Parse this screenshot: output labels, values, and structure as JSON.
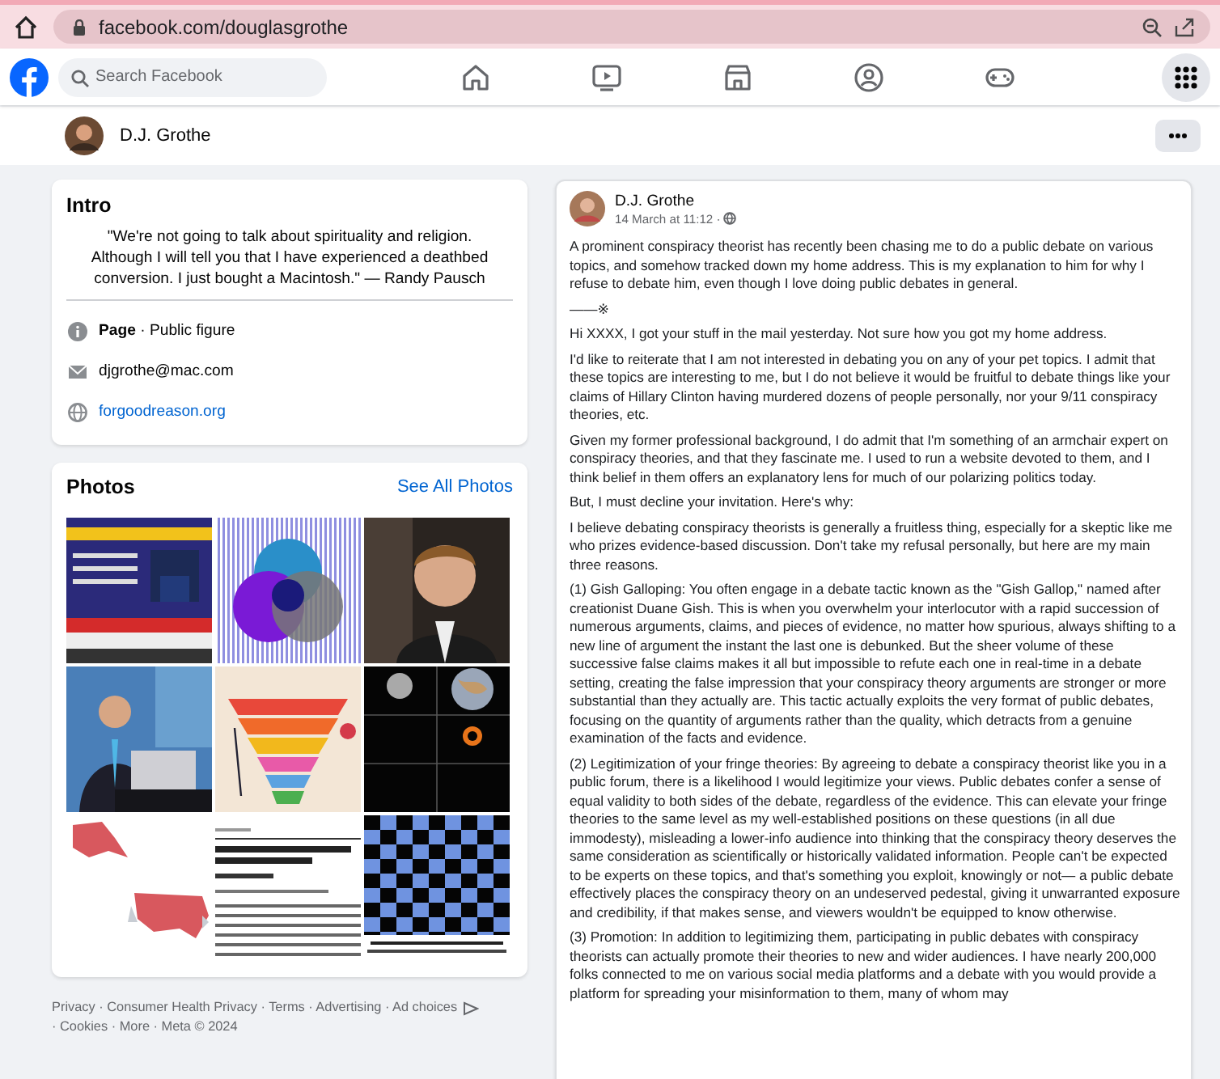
{
  "browser": {
    "url": "facebook.com/douglasgrothe"
  },
  "nav": {
    "search": {
      "placeholder": "Search Facebook"
    }
  },
  "profile": {
    "name": "D.J. Grothe"
  },
  "intro": {
    "title": "Intro",
    "quote": "\"We're not going to talk about spirituality and religion. Although I will tell you that I have experienced a deathbed conversion. I just bought a Macintosh.\" — Randy Pausch",
    "items": [
      {
        "kind": "category",
        "text": "**Page** · Public figure"
      },
      {
        "kind": "email",
        "text": "djgrothe@mac.com"
      },
      {
        "kind": "website",
        "text": "forgoodreason.org"
      }
    ]
  },
  "photos": {
    "title": "Photos",
    "link": "See All Photos"
  },
  "footer": {
    "before_icon": "Privacy · Consumer Health Privacy · Terms · Advertising · Ad choices",
    "after_icon": "· Cookies · More · Meta © 2024"
  },
  "post": {
    "author": "D.J. Grothe",
    "time": "14 March at 11:12 ·",
    "paragraphs": [
      "A prominent conspiracy theorist has recently been chasing me to do a public debate on various topics, and somehow tracked down my home address. This is my explanation to him for why I refuse to debate him, even though I love doing public debates in general.",
      "——※",
      "Hi XXXX, I got your stuff in the mail yesterday. Not sure how you got my home address.",
      "I'd like to reiterate that I am not interested in debating you on any of your pet topics. I admit that these topics are interesting to me, but I do not believe it would be fruitful to debate things like your claims of Hillary Clinton having murdered dozens of people personally, nor your 9/11 conspiracy theories, etc.",
      "Given my former professional background, I do admit that I'm something of an armchair expert on conspiracy theories, and that they fascinate me. I used to run a website devoted to them, and I think belief in them offers an explanatory lens for much of our polarizing politics today.",
      "But, I must decline your invitation. Here's why:",
      "I believe debating conspiracy theorists is generally a fruitless thing, especially for a skeptic like me who prizes evidence-based discussion. Don't take my refusal personally, but here are my main three reasons.",
      "(1) Gish Galloping: You often engage in a debate tactic known as the \"Gish Gallop,\" named after creationist Duane Gish. This is when you overwhelm your interlocutor with a rapid succession of numerous arguments, claims, and pieces of evidence, no matter how spurious, always shifting to a new line of argument the instant the last one is debunked. But the sheer volume of these successive false claims makes it all but impossible to refute each one in real-time in a debate setting, creating the false impression that your conspiracy theory arguments are stronger or more substantial than they actually are. This tactic actually exploits the very format of public debates, focusing on the quantity of arguments rather than the quality, which detracts from a genuine examination of the facts and evidence.",
      "(2) Legitimization of your fringe theories: By agreeing to debate a conspiracy theorist like you in a public forum, there is a likelihood I would legitimize your views. Public debates confer a sense of equal validity to both sides of the debate, regardless of the evidence. This can elevate your fringe theories to the same level as my well-established positions on these questions (in all due immodesty), misleading a lower-info audience into thinking that the conspiracy theory deserves the same consideration as scientifically or historically validated information. People can't be expected to be experts on these topics, and that's something you exploit, knowingly or not— a public debate effectively places the conspiracy theory on an undeserved pedestal, giving it unwarranted exposure and credibility, if that makes sense, and viewers wouldn't be equipped to know otherwise.",
      "(3) Promotion: In addition to legitimizing them, participating in public debates with conspiracy theorists can actually promote their theories to new and wider audiences. I have nearly 200,000 folks connected to me on various social media platforms and a debate with you would provide a platform for spreading your misinformation to them, many of whom may"
    ]
  }
}
